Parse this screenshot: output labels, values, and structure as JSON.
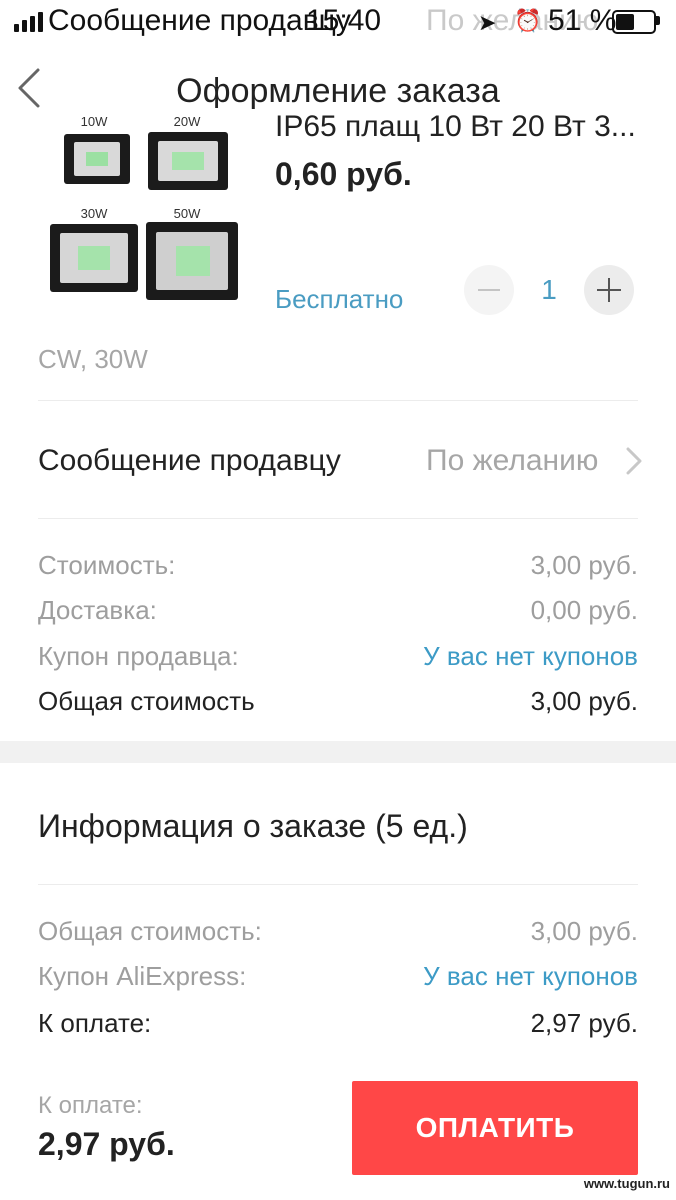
{
  "status_bar": {
    "title": "Сообщение продавцу",
    "time": "15:40",
    "ghost_right": "По желанию",
    "battery_percent": "51 %",
    "battery_level": 0.51,
    "icons": [
      "signal-icon",
      "location-arrow-icon",
      "alarm-icon",
      "battery-icon"
    ]
  },
  "header": {
    "title": "Оформление заказа",
    "back_icon": "chevron-left-icon"
  },
  "product": {
    "title": "IP65 плащ 10 Вт 20 Вт 3...",
    "price": "0,60 руб.",
    "shipping": "Бесплатно",
    "quantity": "1",
    "variant": "CW, 30W",
    "image_labels": [
      "10W",
      "20W",
      "30W",
      "50W"
    ]
  },
  "seller_message": {
    "label": "Сообщение продавцу",
    "value": "По желанию"
  },
  "costs": [
    {
      "label": "Стоимость:",
      "value": "3,00 руб."
    },
    {
      "label": "Доставка:",
      "value": "0,00 руб."
    },
    {
      "label": "Купон продавца:",
      "value": "У вас нет купонов"
    },
    {
      "label": "Общая стоимость",
      "value": "3,00 руб."
    }
  ],
  "order_info": {
    "title": "Информация о заказе (5 ед.)",
    "rows": [
      {
        "label": "Общая стоимость:",
        "value": "3,00 руб."
      },
      {
        "label": "Купон AliExpress:",
        "value": "У вас нет купонов"
      },
      {
        "label": "К оплате:",
        "value": "2,97 руб."
      }
    ]
  },
  "footer": {
    "label": "К оплате:",
    "total": "2,97 руб.",
    "pay_button": "ОПЛАТИТЬ"
  },
  "watermark": "www.tugun.ru",
  "colors": {
    "accent_link": "#3d9bc6",
    "pay_button": "#ff4747",
    "muted_text": "#9e9e9e"
  }
}
